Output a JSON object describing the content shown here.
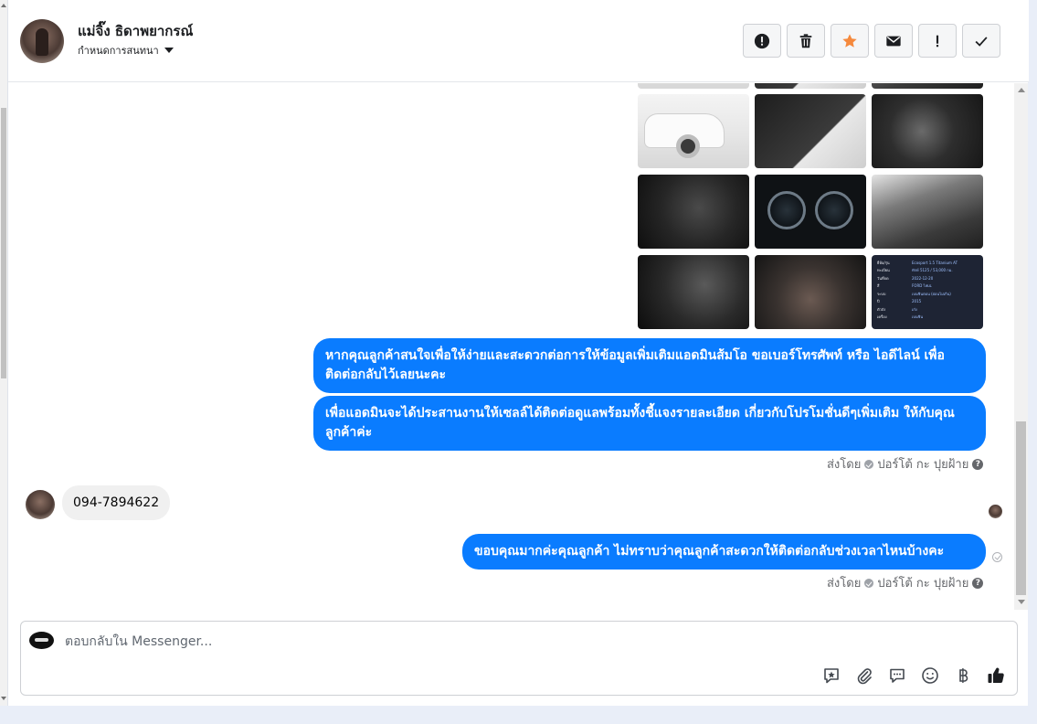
{
  "header": {
    "contact_name": "แม่จิ๊ง ธิดาพยากรณ์",
    "assign_label": "กำหนดการสนทนา"
  },
  "toolbar": {
    "icons": [
      "alert-circle-icon",
      "trash-icon",
      "star-icon",
      "envelope-icon",
      "exclamation-icon",
      "check-icon"
    ],
    "colors": {
      "star": "#f5893d",
      "dark": "#1c1e21"
    }
  },
  "spec_sheet": {
    "rows": [
      {
        "k": "ยี่ห้อ/รุ่น",
        "v": "Ecosport 1.5 Titanium AT"
      },
      {
        "k": "ทะเบียน",
        "v": "ทักษ์ 5125 / 53,000 กม."
      },
      {
        "k": "วันที่จด",
        "v": "2022-12-20"
      },
      {
        "k": "สี",
        "v": "FORD ไฟเน่"
      },
      {
        "k": "ระบบ",
        "v": "เบนซินตอน (ผ่อนไม่เกิน)"
      },
      {
        "k": "ปี",
        "v": "2015"
      },
      {
        "k": "ตัวถัง",
        "v": "เก๋ง"
      },
      {
        "k": "เครื่อง",
        "v": "เบนซิน"
      },
      {
        "k": "เกียร์",
        "v": "อัตโนมัติ"
      }
    ]
  },
  "messages": {
    "out_1": "หากคุณลูกค้าสนใจเพื่อให้ง่ายและสะดวกต่อการให้ข้อมูลเพิ่มเติมแอดมินส้มโอ ขอเบอร์โทรศัพท์ หรือ ไอดีไลน์ เพื่อติดต่อกลับไว้เลยนะคะ",
    "out_2": "เพื่อแอดมินจะได้ประสานงานให้เซลล์ได้ติดต่อดูแลพร้อมทั้งชี้แจงรายละเอียด เกี่ยวกับโปรโมชั่นดีๆเพิ่มเติม ให้กับคุณลูกค้าค่ะ",
    "sent_by_1": {
      "prefix": "ส่งโดย",
      "agent": "ปอร์โต้ กะ ปุยฝ้าย"
    },
    "in_1": "094-7894622",
    "out_3": "ขอบคุณมากค่ะคุณลูกค้า ไม่ทราบว่าคุณลูกค้าสะดวกให้ติดต่อกลับช่วงเวลาไหนบ้างคะ",
    "sent_by_2": {
      "prefix": "ส่งโดย",
      "agent": "ปอร์โต้ กะ ปุยฝ้าย"
    }
  },
  "reply": {
    "placeholder": "ตอบกลับใน Messenger...",
    "icons": [
      "saved-reply-icon",
      "attachment-icon",
      "chat-bubble-icon",
      "emoji-icon",
      "baht-icon",
      "thumbs-up-icon"
    ]
  },
  "colors": {
    "bubble_out": "#0a7cff",
    "bubble_in": "#f0f0f0",
    "muted": "#65676b"
  }
}
